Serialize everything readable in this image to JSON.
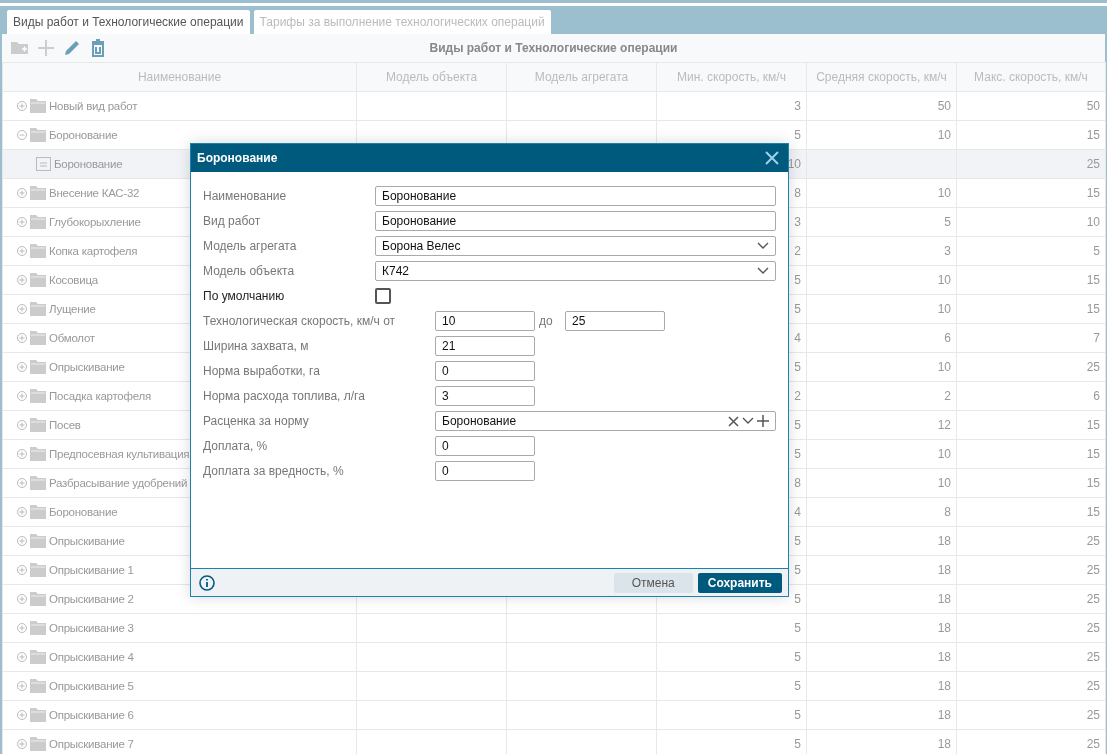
{
  "tabs": [
    {
      "label": "Виды работ и Технологические операции",
      "selected": true
    },
    {
      "label": "Тарифы за выполнение технологических операций",
      "selected": false
    }
  ],
  "toolbar": {
    "tools": [
      {
        "kind": "add-folder",
        "disabled": true
      },
      {
        "kind": "add",
        "disabled": true
      },
      {
        "kind": "edit",
        "disabled": false
      },
      {
        "kind": "delete",
        "disabled": false
      }
    ],
    "title": "Виды работ и Технологические операции"
  },
  "table": {
    "columns": [
      "Наименование",
      "Модель объекта",
      "Модель агрегата",
      "Мин. скорость, км/ч",
      "Средняя скорость, км/ч",
      "Макс. скорость, км/ч"
    ],
    "rows": [
      {
        "name": "Новый вид работ",
        "min": "3",
        "avg": "50",
        "max": "50",
        "expanded": false,
        "selected": false
      },
      {
        "name": "Боронование",
        "min": "5",
        "avg": "10",
        "max": "15",
        "expanded": true,
        "selected": false,
        "children": [
          {
            "name": "Боронование",
            "min": "10",
            "max": "25",
            "selected": true
          }
        ]
      },
      {
        "name": "Внесение КАС-32",
        "min": "8",
        "avg": "10",
        "max": "15",
        "expanded": false,
        "selected": false
      },
      {
        "name": "Глубокорыхление",
        "min": "3",
        "avg": "5",
        "max": "10",
        "expanded": false,
        "selected": false
      },
      {
        "name": "Копка картофеля",
        "min": "2",
        "avg": "3",
        "max": "5",
        "expanded": false,
        "selected": false
      },
      {
        "name": "Косовица",
        "min": "5",
        "avg": "10",
        "max": "15",
        "expanded": false,
        "selected": false
      },
      {
        "name": "Лущение",
        "min": "5",
        "avg": "10",
        "max": "15",
        "expanded": false,
        "selected": false
      },
      {
        "name": "Обмолот",
        "min": "4",
        "avg": "6",
        "max": "7",
        "expanded": false,
        "selected": false
      },
      {
        "name": "Опрыскивание",
        "min": "5",
        "avg": "10",
        "max": "25",
        "expanded": false,
        "selected": false
      },
      {
        "name": "Посадка картофеля",
        "min": "2",
        "avg": "2",
        "max": "6",
        "expanded": false,
        "selected": false
      },
      {
        "name": "Посев",
        "min": "5",
        "avg": "12",
        "max": "15",
        "expanded": false,
        "selected": false
      },
      {
        "name": "Предпосевная культивация",
        "min": "5",
        "avg": "10",
        "max": "15",
        "expanded": false,
        "selected": false
      },
      {
        "name": "Разбрасывание удобрений",
        "min": "8",
        "avg": "10",
        "max": "15",
        "expanded": false,
        "selected": false
      },
      {
        "name": "Боронование",
        "min": "4",
        "avg": "8",
        "max": "15",
        "expanded": false,
        "selected": false
      },
      {
        "name": "Опрыскивание",
        "min": "5",
        "avg": "18",
        "max": "25",
        "expanded": false,
        "selected": false
      },
      {
        "name": "Опрыскивание 1",
        "min": "5",
        "avg": "18",
        "max": "25",
        "expanded": false,
        "selected": false
      },
      {
        "name": "Опрыскивание 2",
        "min": "5",
        "avg": "18",
        "max": "25",
        "expanded": false,
        "selected": false
      },
      {
        "name": "Опрыскивание 3",
        "min": "5",
        "avg": "18",
        "max": "25",
        "expanded": false,
        "selected": false
      },
      {
        "name": "Опрыскивание 4",
        "min": "5",
        "avg": "18",
        "max": "25",
        "expanded": false,
        "selected": false
      },
      {
        "name": "Опрыскивание 5",
        "min": "5",
        "avg": "18",
        "max": "25",
        "expanded": false,
        "selected": false
      },
      {
        "name": "Опрыскивание 6",
        "min": "5",
        "avg": "18",
        "max": "25",
        "expanded": false,
        "selected": false
      },
      {
        "name": "Опрыскивание 7",
        "min": "5",
        "avg": "18",
        "max": "25",
        "expanded": false,
        "selected": false
      }
    ]
  },
  "dialog": {
    "title": "Боронование",
    "fields": [
      {
        "kind": "text",
        "label": "Наименование",
        "value": "Боронование"
      },
      {
        "kind": "text",
        "label": "Вид работ",
        "value": "Боронование"
      },
      {
        "kind": "select",
        "label": "Модель агрегата",
        "value": "Борона Велес"
      },
      {
        "kind": "select",
        "label": "Модель объекта",
        "value": "К742"
      },
      {
        "kind": "checkbox",
        "label": "По умолчанию",
        "checked": false
      },
      {
        "kind": "range",
        "label": "Технологическая скорость, км/ч от",
        "value": "10",
        "separator": "до",
        "value_to": "25"
      },
      {
        "kind": "number",
        "label": "Ширина захвата, м",
        "value": "21"
      },
      {
        "kind": "number",
        "label": "Норма выработки, га",
        "value": "0"
      },
      {
        "kind": "number",
        "label": "Норма расхода топлива, л/га",
        "value": "3"
      },
      {
        "kind": "combo",
        "label": "Расценка за норму",
        "value": "Боронование"
      },
      {
        "kind": "number",
        "label": "Доплата, %",
        "value": "0"
      },
      {
        "kind": "number",
        "label": "Доплата за вредность, %",
        "value": "0"
      }
    ],
    "buttons": [
      {
        "kind": "secondary",
        "label": "Отмена"
      },
      {
        "kind": "primary",
        "label": "Сохранить"
      }
    ]
  }
}
